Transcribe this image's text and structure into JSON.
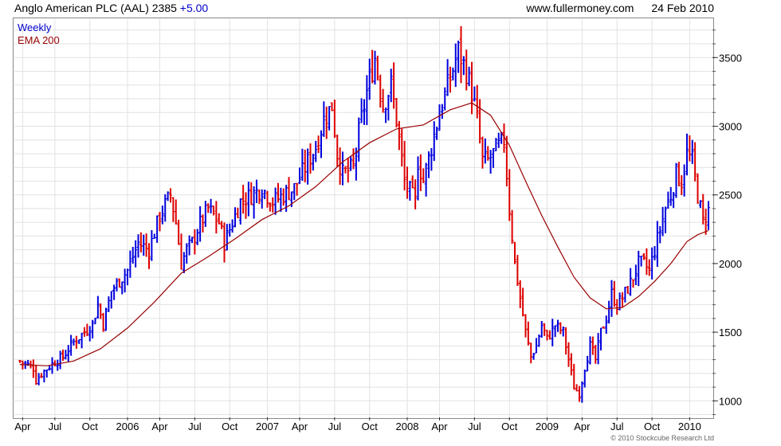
{
  "header": {
    "title": "Anglo American PLC (AAL) 2385",
    "change": "+5.00",
    "source": "www.fullermoney.com",
    "date": "24 Feb 2010"
  },
  "legend": {
    "weekly": "Weekly",
    "ema": "EMA 200"
  },
  "copyright": "© 2010 Stockcube Research Ltd",
  "colors": {
    "up": "#0000dd",
    "down": "#dd0000",
    "ema": "#990000",
    "grid": "#e2e2e2",
    "frame": "#888888"
  },
  "chart_data": {
    "type": "ohlc",
    "title": "Anglo American PLC (AAL) 2385",
    "frequency": "Weekly",
    "ylim": [
      880,
      3780
    ],
    "y_ticks": [
      1000,
      1500,
      2000,
      2500,
      3000,
      3500
    ],
    "x_ticks": [
      {
        "label": "Apr",
        "week": 1
      },
      {
        "label": "Jul",
        "week": 13
      },
      {
        "label": "Oct",
        "week": 26
      },
      {
        "label": "2006",
        "week": 40
      },
      {
        "label": "Apr",
        "week": 52
      },
      {
        "label": "Jul",
        "week": 65
      },
      {
        "label": "Oct",
        "week": 78
      },
      {
        "label": "2007",
        "week": 92
      },
      {
        "label": "Apr",
        "week": 104
      },
      {
        "label": "Jul",
        "week": 117
      },
      {
        "label": "Oct",
        "week": 130
      },
      {
        "label": "2008",
        "week": 144
      },
      {
        "label": "Apr",
        "week": 156
      },
      {
        "label": "Jul",
        "week": 169
      },
      {
        "label": "Oct",
        "week": 182
      },
      {
        "label": "2009",
        "week": 196
      },
      {
        "label": "Apr",
        "week": 209
      },
      {
        "label": "Jul",
        "week": 222
      },
      {
        "label": "Oct",
        "week": 235
      },
      {
        "label": "2010",
        "week": 249
      }
    ],
    "grid": true,
    "series": [
      {
        "name": "Weekly",
        "price_path": [
          [
            0,
            1290
          ],
          [
            5,
            1240
          ],
          [
            6,
            1150
          ],
          [
            8,
            1200
          ],
          [
            12,
            1270
          ],
          [
            16,
            1320
          ],
          [
            20,
            1430
          ],
          [
            24,
            1500
          ],
          [
            27,
            1560
          ],
          [
            29,
            1700
          ],
          [
            31,
            1560
          ],
          [
            34,
            1800
          ],
          [
            40,
            1950
          ],
          [
            44,
            2150
          ],
          [
            48,
            2100
          ],
          [
            52,
            2350
          ],
          [
            56,
            2500
          ],
          [
            58,
            2300
          ],
          [
            60,
            2000
          ],
          [
            62,
            2100
          ],
          [
            64,
            2150
          ],
          [
            66,
            2250
          ],
          [
            70,
            2400
          ],
          [
            74,
            2300
          ],
          [
            76,
            2150
          ],
          [
            78,
            2250
          ],
          [
            82,
            2450
          ],
          [
            86,
            2500
          ],
          [
            90,
            2550
          ],
          [
            94,
            2450
          ],
          [
            98,
            2500
          ],
          [
            102,
            2550
          ],
          [
            106,
            2700
          ],
          [
            110,
            2850
          ],
          [
            113,
            3050
          ],
          [
            116,
            3150
          ],
          [
            118,
            2800
          ],
          [
            120,
            2650
          ],
          [
            124,
            2700
          ],
          [
            126,
            2950
          ],
          [
            129,
            3250
          ],
          [
            132,
            3500
          ],
          [
            135,
            3150
          ],
          [
            138,
            3300
          ],
          [
            140,
            3050
          ],
          [
            143,
            2600
          ],
          [
            147,
            2450
          ],
          [
            148,
            2750
          ],
          [
            150,
            2600
          ],
          [
            153,
            2850
          ],
          [
            156,
            3100
          ],
          [
            160,
            3350
          ],
          [
            163,
            3550
          ],
          [
            166,
            3400
          ],
          [
            168,
            3250
          ],
          [
            170,
            3050
          ],
          [
            172,
            2750
          ],
          [
            174,
            2750
          ],
          [
            176,
            2800
          ],
          [
            180,
            2900
          ],
          [
            182,
            2400
          ],
          [
            184,
            2000
          ],
          [
            186,
            1750
          ],
          [
            188,
            1500
          ],
          [
            190,
            1320
          ],
          [
            192,
            1400
          ],
          [
            194,
            1550
          ],
          [
            196,
            1450
          ],
          [
            199,
            1550
          ],
          [
            202,
            1500
          ],
          [
            204,
            1300
          ],
          [
            206,
            1100
          ],
          [
            208,
            1050
          ],
          [
            210,
            1250
          ],
          [
            212,
            1400
          ],
          [
            214,
            1300
          ],
          [
            216,
            1500
          ],
          [
            218,
            1600
          ],
          [
            220,
            1780
          ],
          [
            222,
            1700
          ],
          [
            224,
            1750
          ],
          [
            226,
            1820
          ],
          [
            228,
            1900
          ],
          [
            230,
            2000
          ],
          [
            232,
            2000
          ],
          [
            234,
            1950
          ],
          [
            236,
            2100
          ],
          [
            238,
            2250
          ],
          [
            240,
            2400
          ],
          [
            242,
            2500
          ],
          [
            244,
            2650
          ],
          [
            246,
            2600
          ],
          [
            248,
            2800
          ],
          [
            250,
            2750
          ],
          [
            252,
            2500
          ],
          [
            254,
            2300
          ],
          [
            255,
            2350
          ],
          [
            256,
            2385
          ]
        ]
      },
      {
        "name": "EMA 200",
        "values": [
          [
            0,
            1265
          ],
          [
            10,
            1255
          ],
          [
            20,
            1290
          ],
          [
            30,
            1380
          ],
          [
            40,
            1530
          ],
          [
            50,
            1720
          ],
          [
            60,
            1930
          ],
          [
            70,
            2050
          ],
          [
            80,
            2180
          ],
          [
            90,
            2320
          ],
          [
            100,
            2420
          ],
          [
            110,
            2560
          ],
          [
            120,
            2740
          ],
          [
            130,
            2880
          ],
          [
            140,
            2980
          ],
          [
            150,
            3010
          ],
          [
            160,
            3120
          ],
          [
            168,
            3170
          ],
          [
            175,
            3080
          ],
          [
            182,
            2860
          ],
          [
            188,
            2600
          ],
          [
            194,
            2350
          ],
          [
            200,
            2120
          ],
          [
            206,
            1900
          ],
          [
            212,
            1750
          ],
          [
            218,
            1670
          ],
          [
            224,
            1680
          ],
          [
            230,
            1760
          ],
          [
            236,
            1870
          ],
          [
            242,
            2000
          ],
          [
            248,
            2160
          ],
          [
            252,
            2210
          ],
          [
            256,
            2240
          ]
        ]
      }
    ]
  }
}
